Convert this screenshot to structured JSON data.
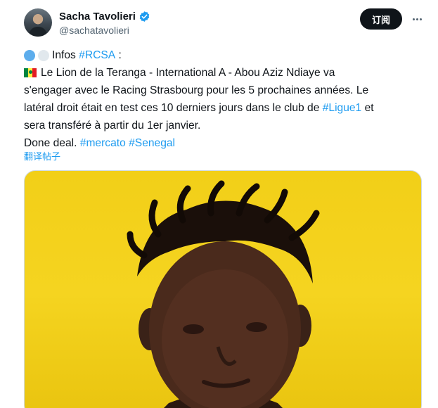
{
  "author": {
    "name": "Sacha Tavolieri",
    "handle": "@sachatavolieri",
    "verified": true
  },
  "follow_button": {
    "label": "订阅"
  },
  "post": {
    "lines": [
      {
        "prefix_icons": [
          "blue-circle",
          "white-circle"
        ],
        "text": "Infos ",
        "hashtag": "#RCSA",
        "suffix": " :"
      },
      {
        "prefix_icon": "senegal-flag",
        "text": "Le Lion de la Teranga - International A - Abou Aziz Ndiaye va"
      },
      {
        "text": "s'engager avec le Racing Strasbourg pour les 5 prochaines années. Le"
      },
      {
        "text": "latéral droit était en test ces 10 derniers jours dans le club de ",
        "hashtag": "#Ligue1",
        "suffix": " et"
      },
      {
        "text": "sera transféré à partir du 1er janvier."
      },
      {
        "text": "Done deal. ",
        "hashtag": "#mercato",
        "hashtag2": "#Senegal"
      }
    ]
  },
  "translate_link": "翻译帖子",
  "colors": {
    "link": "#1d9bf0",
    "text": "#0f1419",
    "secondary": "#536471",
    "photo_background": "#f2cf18"
  }
}
